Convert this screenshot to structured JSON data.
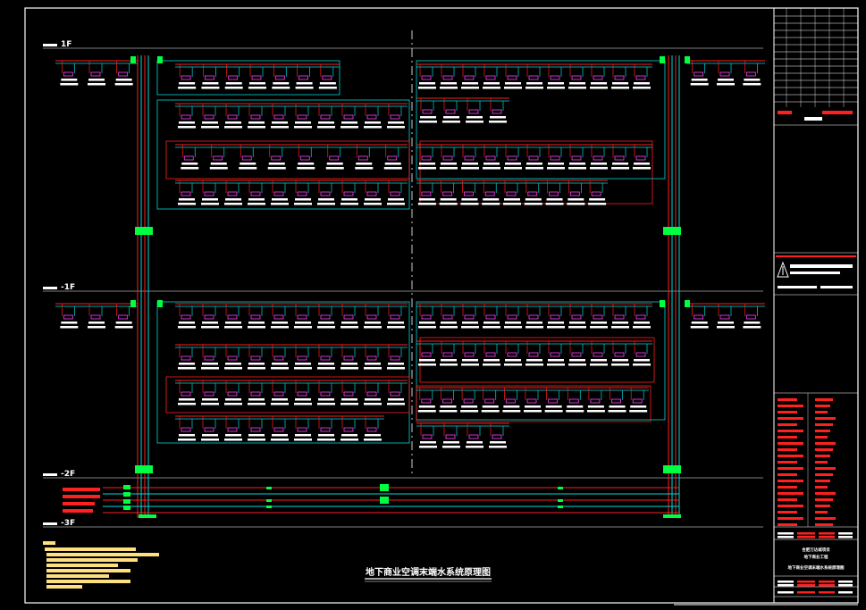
{
  "drawing": {
    "title": "地下商业空调末端水系统原理图",
    "levels": [
      {
        "id": "1f",
        "label": "1F"
      },
      {
        "id": "b1",
        "label": "-1F"
      },
      {
        "id": "b2",
        "label": "-2F"
      },
      {
        "id": "b3",
        "label": "-3F"
      }
    ]
  },
  "title_block": {
    "project_lines": [
      "合肥万达城项目",
      "地下商业工程"
    ],
    "sheet_title": "地下商业空调末端水系统原理图"
  },
  "colors": {
    "background": "#000000",
    "supply_pipe": "#ff2020",
    "return_pipe": "#00d8d8",
    "fan_coil": "#ff40ff",
    "valve": "#00ff40",
    "frame": "#ffffff",
    "notes": "#ffe080",
    "centerline": "#ffffff"
  }
}
